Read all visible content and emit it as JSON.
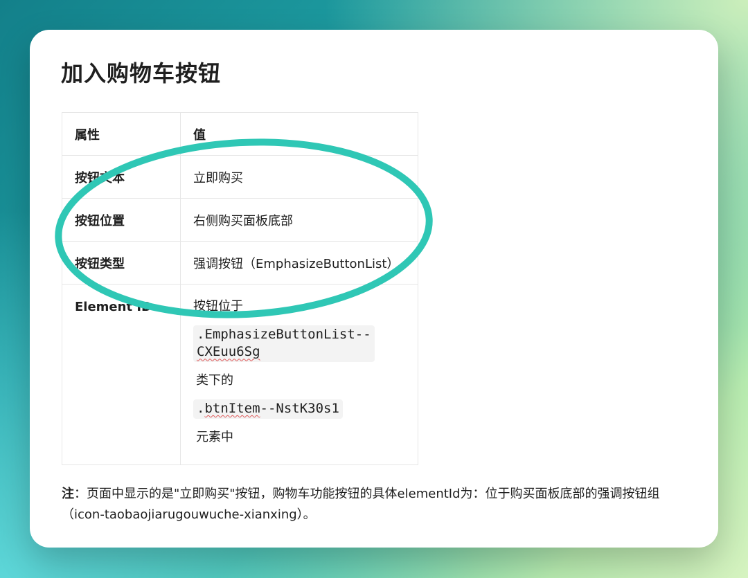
{
  "card": {
    "title": "加入购物车按钮",
    "table": {
      "headers": [
        "属性",
        "值"
      ],
      "rows": [
        {
          "key": "按钮文本",
          "value": "立即购买"
        },
        {
          "key": "按钮位置",
          "value": "右侧购买面板底部"
        },
        {
          "key": "按钮类型",
          "value": "强调按钮（EmphasizeButtonList）"
        }
      ],
      "element_id": {
        "key": "Element ID",
        "line1": "按钮位于",
        "code1a": ".EmphasizeButtonList--",
        "code1b": "CXEuu6Sg",
        "line2": "类下的",
        "code2_prefix": ".",
        "code2_word": "btnItem",
        "code2_suffix": "--NstK30s1",
        "line3": "元素中"
      }
    },
    "note": {
      "label": "注",
      "line1": "：页面中显示的是\"立即购买\"按钮，购物车功能按钮的具体elementId为：位于购买面板底部的强调按钮组",
      "line2": "（icon-taobaojiarugouwuche-xianxing）。"
    }
  },
  "colors": {
    "annotation_ellipse": "#2fc7b5",
    "background_start": "#13808a",
    "background_end": "#d6f3c0"
  }
}
